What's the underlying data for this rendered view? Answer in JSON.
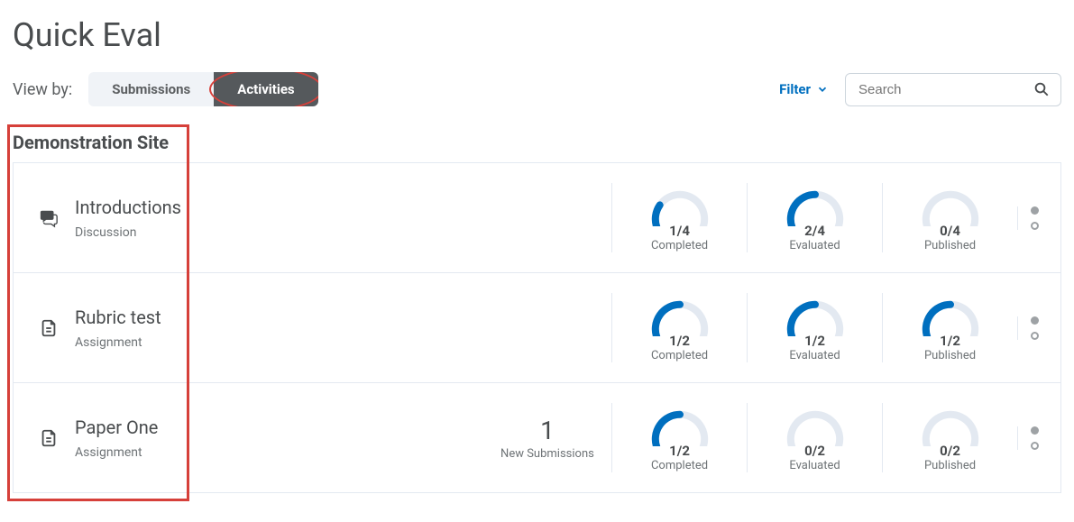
{
  "page_title": "Quick Eval",
  "view_by_label": "View by:",
  "tabs": {
    "submissions": "Submissions",
    "activities": "Activities",
    "active": "activities"
  },
  "filter_label": "Filter",
  "search_placeholder": "Search",
  "section_title": "Demonstration Site",
  "gauge_colors": {
    "track": "#e3e9f1",
    "fill": "#006fbf"
  },
  "activities": [
    {
      "icon": "discussion",
      "title": "Introductions",
      "type": "Discussion",
      "new_submissions": null,
      "new_submissions_label": "",
      "gauges": [
        {
          "value": "1/4",
          "label": "Completed",
          "num": 1,
          "den": 4
        },
        {
          "value": "2/4",
          "label": "Evaluated",
          "num": 2,
          "den": 4
        },
        {
          "value": "0/4",
          "label": "Published",
          "num": 0,
          "den": 4
        }
      ]
    },
    {
      "icon": "assignment",
      "title": "Rubric test",
      "type": "Assignment",
      "new_submissions": null,
      "new_submissions_label": "",
      "gauges": [
        {
          "value": "1/2",
          "label": "Completed",
          "num": 1,
          "den": 2
        },
        {
          "value": "1/2",
          "label": "Evaluated",
          "num": 1,
          "den": 2
        },
        {
          "value": "1/2",
          "label": "Published",
          "num": 1,
          "den": 2
        }
      ]
    },
    {
      "icon": "assignment",
      "title": "Paper One",
      "type": "Assignment",
      "new_submissions": "1",
      "new_submissions_label": "New Submissions",
      "gauges": [
        {
          "value": "1/2",
          "label": "Completed",
          "num": 1,
          "den": 2
        },
        {
          "value": "0/2",
          "label": "Evaluated",
          "num": 0,
          "den": 2
        },
        {
          "value": "0/2",
          "label": "Published",
          "num": 0,
          "den": 2
        }
      ]
    }
  ],
  "annotations": {
    "activities_circle": true,
    "left_box": true
  }
}
